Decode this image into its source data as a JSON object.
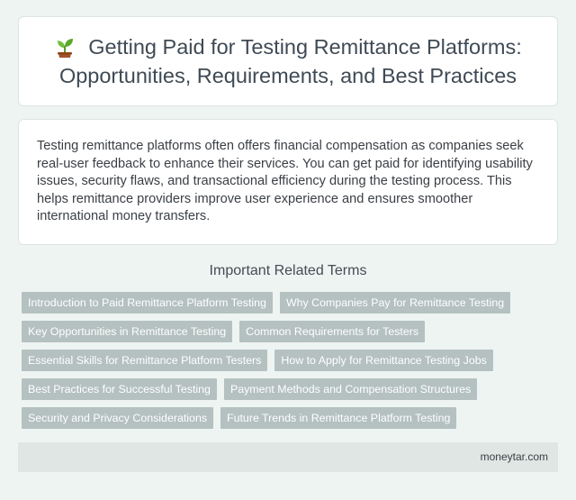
{
  "header": {
    "icon": "seedling-icon",
    "title": "Getting Paid for Testing Remittance Platforms: Opportunities, Requirements, and Best Practices"
  },
  "intro": {
    "text": "Testing remittance platforms often offers financial compensation as companies seek real-user feedback to enhance their services. You can get paid for identifying usability issues, security flaws, and transactional efficiency during the testing process. This helps remittance providers improve user experience and ensures smoother international money transfers."
  },
  "related": {
    "heading": "Important Related Terms",
    "terms": [
      "Introduction to Paid Remittance Platform Testing",
      "Why Companies Pay for Remittance Testing",
      "Key Opportunities in Remittance Testing",
      "Common Requirements for Testers",
      "Essential Skills for Remittance Platform Testers",
      "How to Apply for Remittance Testing Jobs",
      "Best Practices for Successful Testing",
      "Payment Methods and Compensation Structures",
      "Security and Privacy Considerations",
      "Future Trends in Remittance Platform Testing"
    ]
  },
  "footer": {
    "site": "moneytar.com"
  },
  "colors": {
    "background": "#eef4f1",
    "tag": "#b4c1c0",
    "title_text": "#3f4a55"
  }
}
